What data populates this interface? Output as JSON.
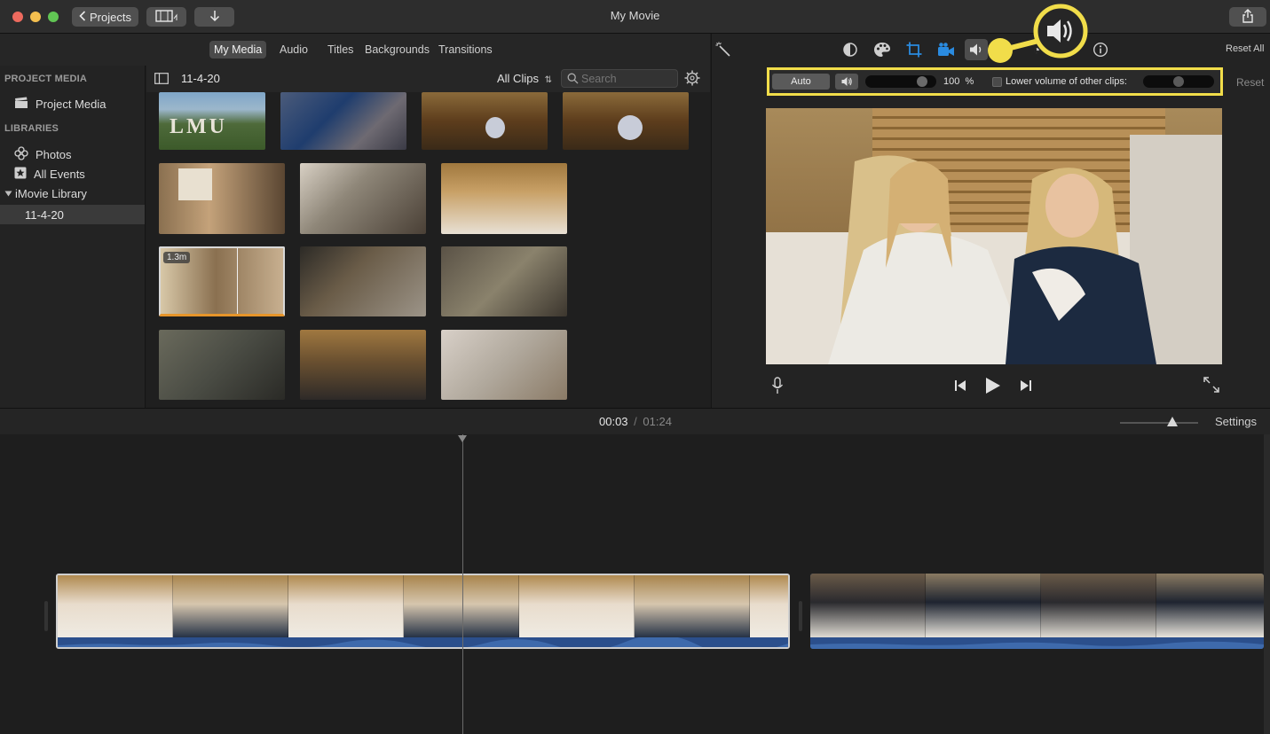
{
  "window": {
    "title": "My Movie"
  },
  "titlebar": {
    "projects_label": "Projects"
  },
  "tabs": [
    "My Media",
    "Audio",
    "Titles",
    "Backgrounds",
    "Transitions"
  ],
  "sidebar": {
    "project_media_head": "PROJECT MEDIA",
    "project_media_item": "Project Media",
    "libraries_head": "LIBRARIES",
    "items": [
      "Photos",
      "All Events"
    ],
    "library": "iMovie Library",
    "event": "11-4-20"
  },
  "browser": {
    "event_title": "11-4-20",
    "filter": "All Clips",
    "search_placeholder": "Search",
    "duration_badge": "1.3m",
    "lmu_text": "LMU"
  },
  "viewer": {
    "reset_all": "Reset All",
    "reset": "Reset",
    "auto_label": "Auto",
    "volume_value": "100",
    "volume_unit": "%",
    "lower_volume_label": "Lower volume of other clips:",
    "volume_level": 0.85,
    "lower_volume_level": 0.5
  },
  "timeline": {
    "current_time": "00:03",
    "separator": "/",
    "total_time": "01:24",
    "settings_label": "Settings",
    "zoom_level": 0.7
  },
  "colors": {
    "highlight": "#f1dd4a",
    "accent_blue": "#2a8be0",
    "audio_wave": "#2b4f8c"
  },
  "icons": [
    "chevron-left-icon",
    "film-icon",
    "download-icon",
    "share-icon",
    "sidebar-toggle-icon",
    "search-icon",
    "gear-icon",
    "magic-wand-icon",
    "color-balance-icon",
    "color-palette-icon",
    "crop-icon",
    "camera-icon",
    "volume-icon",
    "info-icon",
    "microphone-icon",
    "skip-back-icon",
    "play-icon",
    "skip-forward-icon",
    "fullscreen-icon"
  ]
}
